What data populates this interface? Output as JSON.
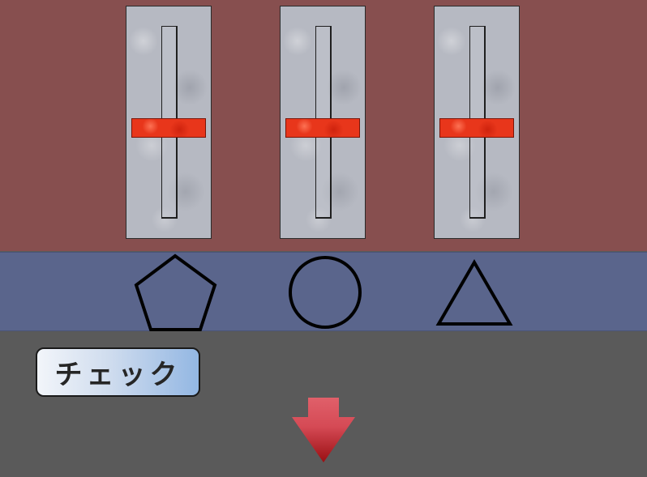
{
  "sliders": [
    {
      "id": "slider-1",
      "level": 0.5
    },
    {
      "id": "slider-2",
      "level": 0.5
    },
    {
      "id": "slider-3",
      "level": 0.5
    }
  ],
  "shapes": [
    "pentagon-icon",
    "circle-icon",
    "triangle-icon"
  ],
  "check_button": {
    "label": "チェック"
  },
  "down_arrow": {
    "icon": "down-arrow-icon"
  },
  "colors": {
    "top_panel": "#874f4f",
    "shape_panel": "#5a658c",
    "background": "#5a5a5a",
    "slider_thumb": "#e8361b",
    "arrow": "#d9525e"
  }
}
